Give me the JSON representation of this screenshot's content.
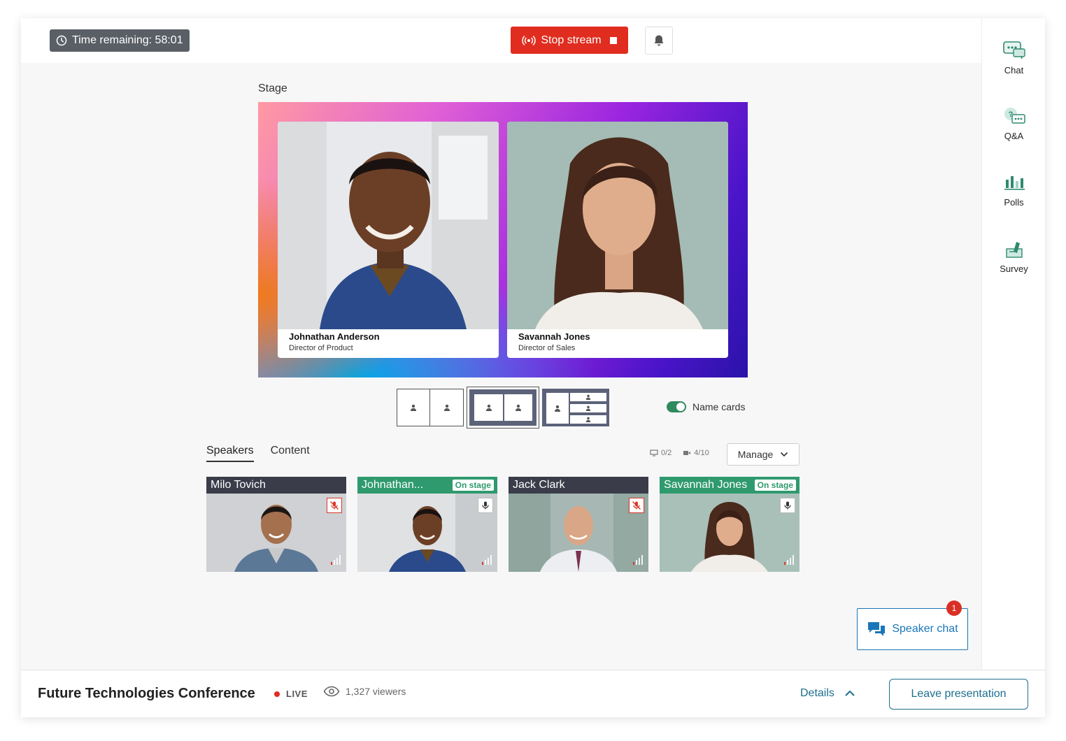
{
  "header": {
    "timer_text": "Time remaining: 58:01",
    "stop_stream_label": "Stop stream",
    "bell_icon": "bell-icon"
  },
  "sidebar": {
    "items": [
      {
        "label": "Chat",
        "icon": "chat-icon"
      },
      {
        "label": "Q&A",
        "icon": "qa-icon"
      },
      {
        "label": "Polls",
        "icon": "polls-icon"
      },
      {
        "label": "Survey",
        "icon": "survey-icon"
      }
    ]
  },
  "stage": {
    "label": "Stage",
    "cards": [
      {
        "name": "Johnathan Anderson",
        "title": "Director of Product"
      },
      {
        "name": "Savannah Jones",
        "title": "Director of Sales"
      }
    ]
  },
  "name_cards": {
    "label": "Name cards",
    "enabled": true
  },
  "tabs": [
    {
      "label": "Speakers",
      "active": true
    },
    {
      "label": "Content",
      "active": false
    }
  ],
  "counts": {
    "screens": "0/2",
    "cameras": "4/10"
  },
  "manage_label": "Manage",
  "speakers": [
    {
      "name": "Milo Tovich",
      "on_stage": false,
      "muted": true
    },
    {
      "name": "Johnathan...",
      "on_stage": true,
      "muted": false
    },
    {
      "name": "Jack Clark",
      "on_stage": false,
      "muted": true
    },
    {
      "name": "Savannah Jones",
      "on_stage": true,
      "muted": false
    }
  ],
  "on_stage_label": "On stage",
  "speaker_chat": {
    "label": "Speaker chat",
    "badge": "1"
  },
  "footer": {
    "title": "Future Technologies Conference",
    "live_label": "LIVE",
    "viewers": "1,327 viewers",
    "details_label": "Details",
    "leave_label": "Leave presentation"
  },
  "colors": {
    "stop_red": "#e02d1f",
    "on_stage_green": "#2f9a6e",
    "accent_teal": "#1d6f8e",
    "chat_blue": "#1976b9"
  }
}
